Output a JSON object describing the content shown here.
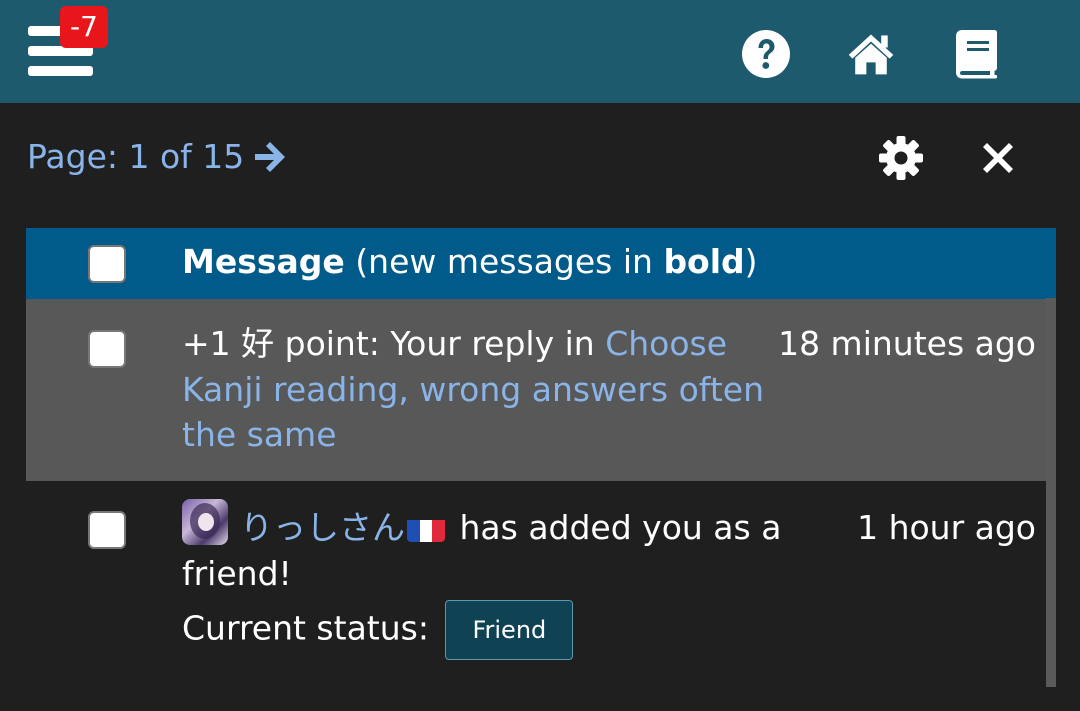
{
  "header": {
    "notification_count": "-7",
    "icons": [
      "menu-icon",
      "help-icon",
      "home-icon",
      "book-icon"
    ]
  },
  "pager": {
    "text": "Page: 1 of 15"
  },
  "table": {
    "header_bold": "Message",
    "header_mid": "(new messages in",
    "header_bold2": "bold",
    "header_end": ")"
  },
  "rows": [
    {
      "prefix": "+1 好 point: Your reply in",
      "link": "Choose Kanji reading, wrong answers often the same",
      "time": "18 minutes ago"
    },
    {
      "user": "りっしさん",
      "text1": "has added you as a friend!",
      "status_label": "Current status:",
      "status_button": "Friend",
      "time": "1 hour ago"
    }
  ],
  "colors": {
    "topbar": "#1d5a6e",
    "background": "#1f1f1f",
    "table_header": "#005a8a",
    "unread_row": "#585858",
    "link": "#8ab4e8",
    "badge": "#e8161b"
  }
}
